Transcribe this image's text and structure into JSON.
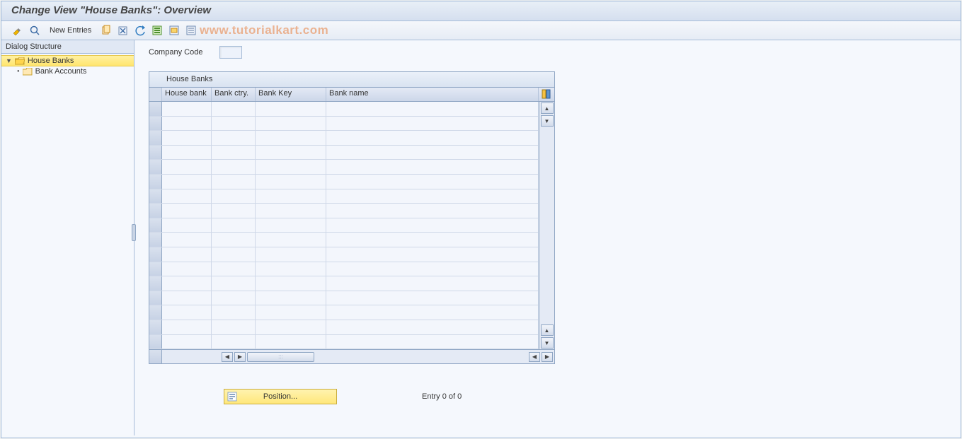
{
  "header": {
    "title": "Change View \"House Banks\": Overview"
  },
  "watermark": "www.tutorialkart.com",
  "toolbar": {
    "new_entries_label": "New Entries",
    "icons": [
      "toggle-display-change",
      "details",
      "copy",
      "delete",
      "undo",
      "select-all",
      "select-block",
      "deselect-all"
    ]
  },
  "sidebar": {
    "header": "Dialog Structure",
    "items": [
      {
        "key": "house-banks",
        "label": "House Banks",
        "selected": true,
        "open": true
      },
      {
        "key": "bank-accounts",
        "label": "Bank Accounts",
        "selected": false,
        "open": false
      }
    ]
  },
  "main": {
    "company_code_label": "Company Code",
    "company_code_value": ""
  },
  "table": {
    "title": "House Banks",
    "columns": {
      "house_bank": "House bank",
      "bank_ctry": "Bank ctry.",
      "bank_key": "Bank Key",
      "bank_name": "Bank name"
    },
    "rows": [
      {
        "house_bank": "",
        "bank_ctry": "",
        "bank_key": "",
        "bank_name": ""
      },
      {
        "house_bank": "",
        "bank_ctry": "",
        "bank_key": "",
        "bank_name": ""
      },
      {
        "house_bank": "",
        "bank_ctry": "",
        "bank_key": "",
        "bank_name": ""
      },
      {
        "house_bank": "",
        "bank_ctry": "",
        "bank_key": "",
        "bank_name": ""
      },
      {
        "house_bank": "",
        "bank_ctry": "",
        "bank_key": "",
        "bank_name": ""
      },
      {
        "house_bank": "",
        "bank_ctry": "",
        "bank_key": "",
        "bank_name": ""
      },
      {
        "house_bank": "",
        "bank_ctry": "",
        "bank_key": "",
        "bank_name": ""
      },
      {
        "house_bank": "",
        "bank_ctry": "",
        "bank_key": "",
        "bank_name": ""
      },
      {
        "house_bank": "",
        "bank_ctry": "",
        "bank_key": "",
        "bank_name": ""
      },
      {
        "house_bank": "",
        "bank_ctry": "",
        "bank_key": "",
        "bank_name": ""
      },
      {
        "house_bank": "",
        "bank_ctry": "",
        "bank_key": "",
        "bank_name": ""
      },
      {
        "house_bank": "",
        "bank_ctry": "",
        "bank_key": "",
        "bank_name": ""
      },
      {
        "house_bank": "",
        "bank_ctry": "",
        "bank_key": "",
        "bank_name": ""
      },
      {
        "house_bank": "",
        "bank_ctry": "",
        "bank_key": "",
        "bank_name": ""
      },
      {
        "house_bank": "",
        "bank_ctry": "",
        "bank_key": "",
        "bank_name": ""
      },
      {
        "house_bank": "",
        "bank_ctry": "",
        "bank_key": "",
        "bank_name": ""
      },
      {
        "house_bank": "",
        "bank_ctry": "",
        "bank_key": "",
        "bank_name": ""
      }
    ]
  },
  "footer": {
    "position_label": "Position...",
    "entry_text": "Entry 0 of 0"
  }
}
